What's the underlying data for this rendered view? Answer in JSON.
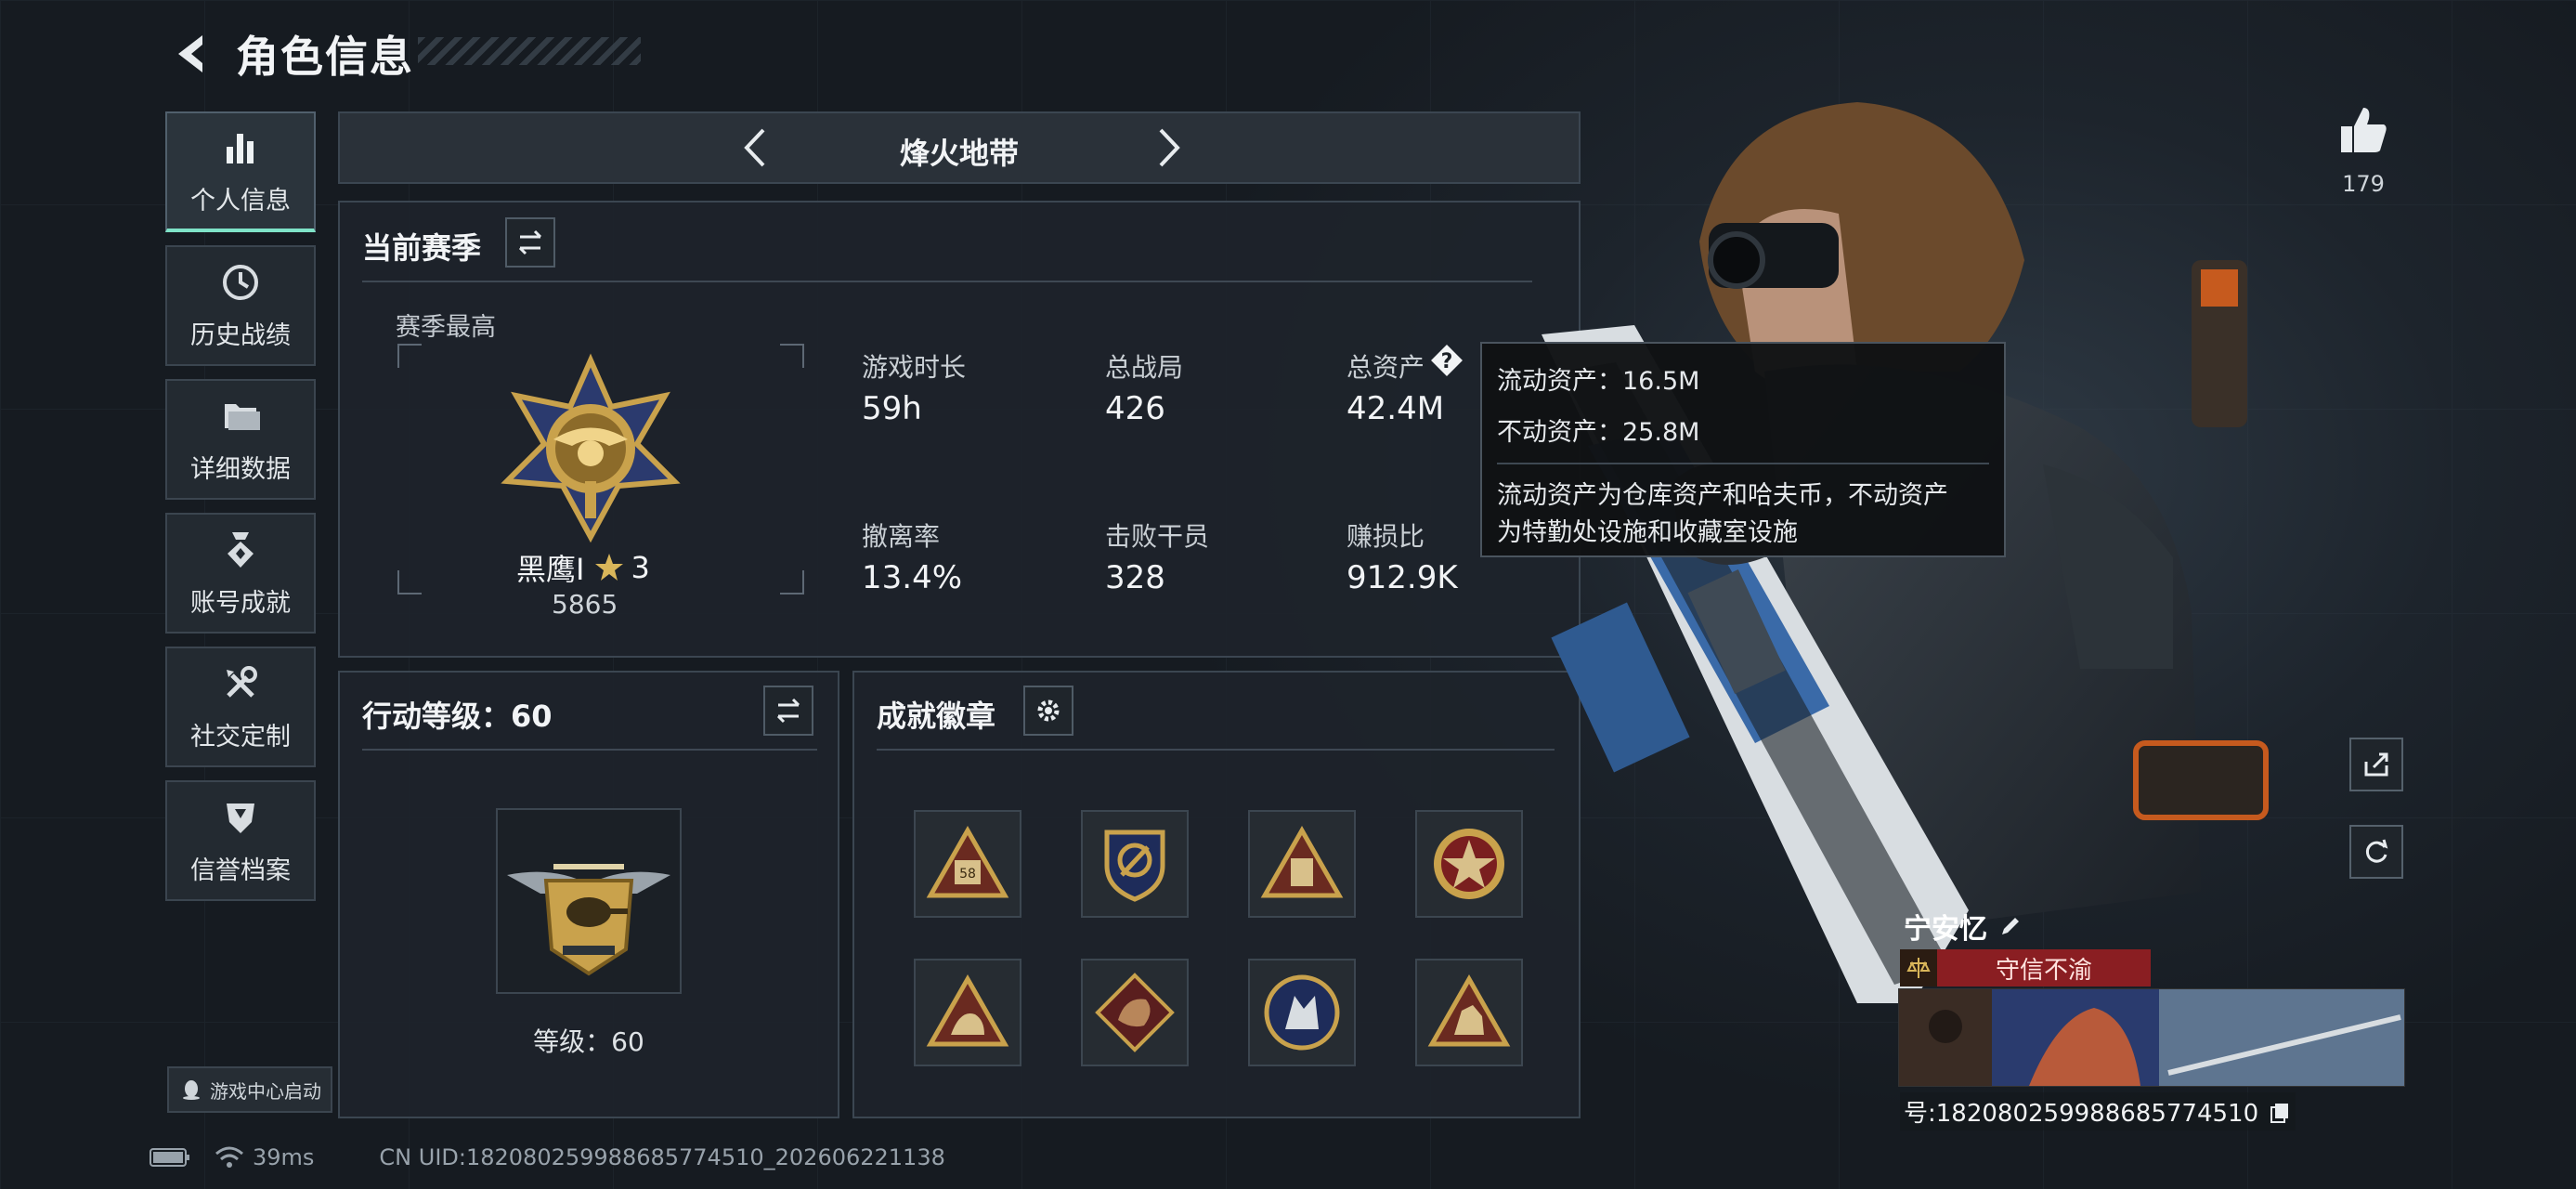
{
  "header": {
    "title": "角色信息"
  },
  "sidebar": {
    "items": [
      {
        "label": "个人信息"
      },
      {
        "label": "历史战绩"
      },
      {
        "label": "详细数据"
      },
      {
        "label": "账号成就"
      },
      {
        "label": "社交定制"
      },
      {
        "label": "信誉档案"
      }
    ],
    "launcher_label": "游戏中心启动"
  },
  "mode": {
    "title": "烽火地带"
  },
  "season": {
    "title": "当前赛季",
    "best_label": "赛季最高",
    "rank_name": "黑鹰I",
    "rank_stars": "3",
    "rank_points": "5865",
    "stats": [
      {
        "label": "游戏时长",
        "value": "59h"
      },
      {
        "label": "总战局",
        "value": "426"
      },
      {
        "label": "总资产",
        "value": "42.4M"
      },
      {
        "label": "撤离率",
        "value": "13.4%"
      },
      {
        "label": "击败干员",
        "value": "328"
      },
      {
        "label": "赚损比",
        "value": "912.9K"
      }
    ]
  },
  "tooltip": {
    "liquid": "流动资产：16.5M",
    "fixed": "不动资产：25.8M",
    "desc_line1": "流动资产为仓库资产和哈夫币，不动资产",
    "desc_line2": "为特勤处设施和收藏室设施"
  },
  "action_level": {
    "title": "行动等级：60",
    "level_label": "等级：60"
  },
  "achievements": {
    "title": "成就徽章",
    "badge_count": 8,
    "badge_58_text": "58"
  },
  "social": {
    "likes": "179"
  },
  "player": {
    "name": "宁安忆",
    "motto": "守信不渝",
    "id_text": "号:18208025998868577451​0"
  },
  "status": {
    "ping": "39ms",
    "uid": "CN UID:18208025998868577451​0_202606221138"
  },
  "colors": {
    "accent": "#7fe3c8",
    "motto_bg": "#8a1e22",
    "gold": "#c9a24c"
  }
}
